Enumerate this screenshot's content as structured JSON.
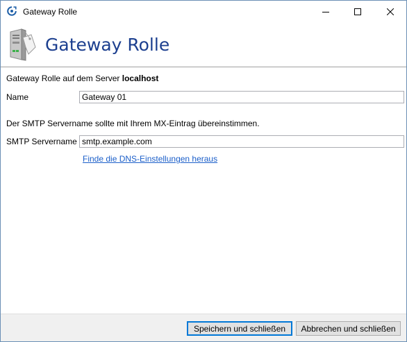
{
  "window": {
    "title": "Gateway Rolle",
    "controls": {
      "minimize_icon": "minimize-icon",
      "maximize_icon": "maximize-icon",
      "close_icon": "close-icon"
    }
  },
  "header": {
    "title": "Gateway Rolle",
    "icon": "server-tag-icon",
    "title_color": "#1c3f8f"
  },
  "form": {
    "server_line_prefix": "Gateway Rolle auf dem Server",
    "server_name": "localhost",
    "name_label": "Name",
    "name_value": "Gateway 01",
    "smtp_hint": "Der SMTP Servername sollte mit Ihrem MX-Eintrag übereinstimmen.",
    "smtp_label": "SMTP Servername",
    "smtp_value": "smtp.example.com",
    "dns_link": "Finde die DNS-Einstellungen heraus",
    "link_color": "#1a5ec9"
  },
  "footer": {
    "save_label": "Speichern und schließen",
    "cancel_label": "Abbrechen und schließen"
  }
}
